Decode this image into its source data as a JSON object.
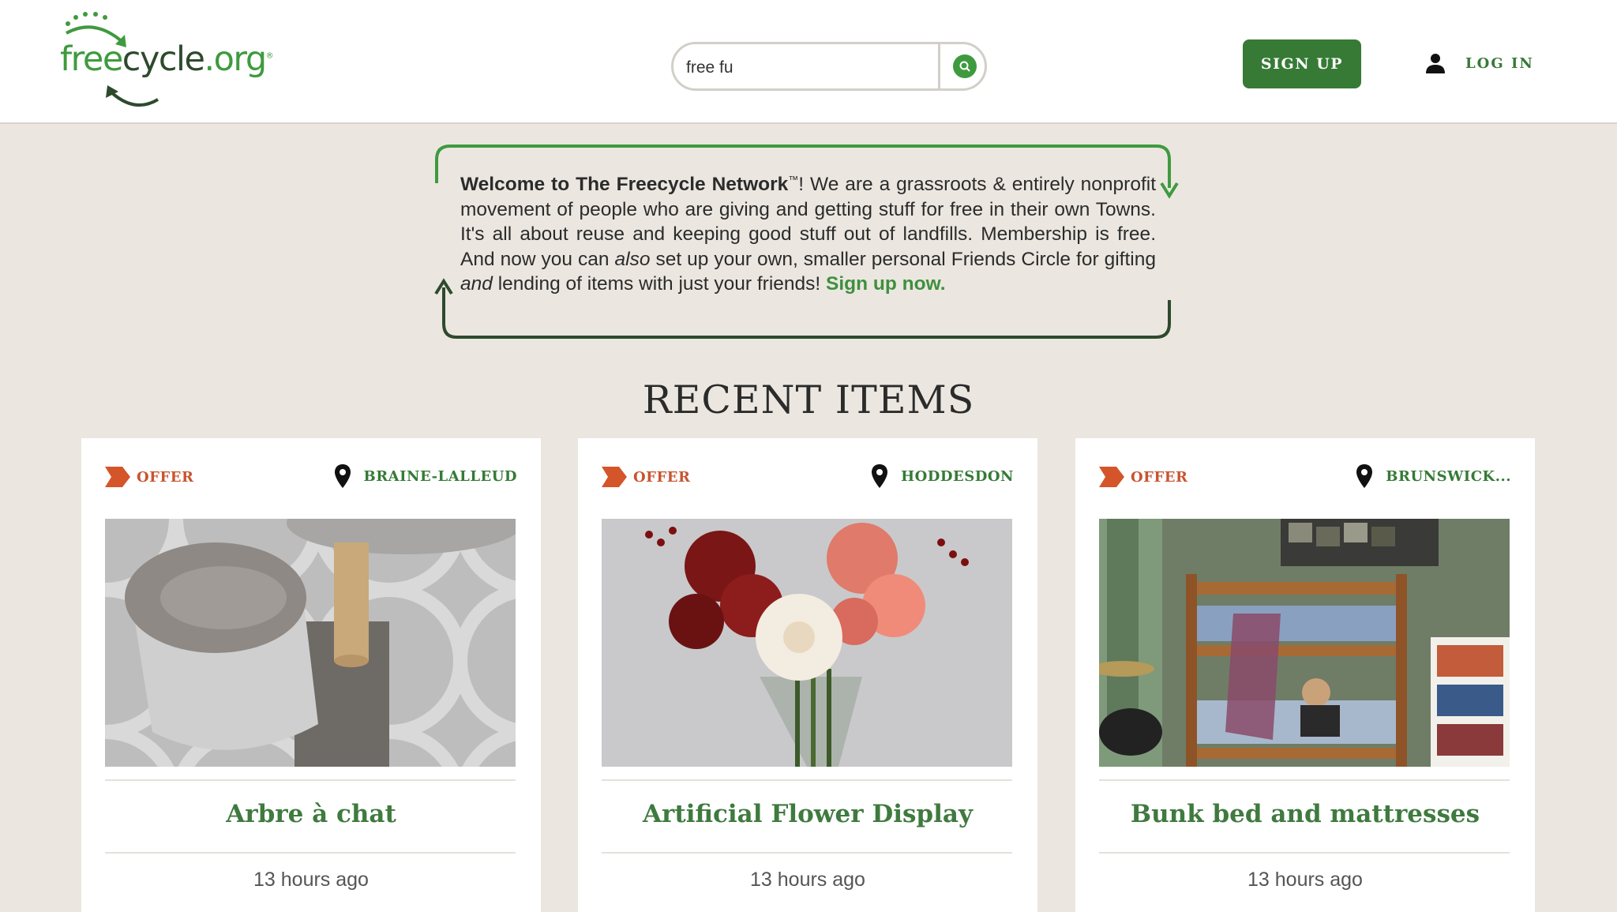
{
  "header": {
    "logo": {
      "free": "free",
      "cycle": "cycle",
      "org": ".org",
      "registered": "®"
    },
    "search": {
      "value": "free fu"
    },
    "signup_label": "SIGN UP",
    "login_label": "LOG IN"
  },
  "welcome": {
    "bold": "Welcome to The Freecycle Network",
    "tm": "™",
    "text1": "! We are a grassroots & entirely nonprofit movement of people who are giving and getting stuff for free in their own Towns. It's all about reuse and keeping good stuff out of landfills. Membership is free. And now you can ",
    "also": "also",
    "text2": " set up your own, smaller personal Friends Circle for gifting ",
    "and": "and",
    "text3": " lending of items with just your friends! ",
    "link": "Sign up now."
  },
  "section_title": "RECENT ITEMS",
  "items": [
    {
      "type": "OFFER",
      "location": "BRAINE-LALLEUD",
      "title": "Arbre à chat",
      "time": "13 hours ago"
    },
    {
      "type": "OFFER",
      "location": "HODDESDON",
      "title": "Artificial Flower Display",
      "time": "13 hours ago"
    },
    {
      "type": "OFFER",
      "location": "BRUNSWICK...",
      "title": "Bunk bed and mattresses",
      "time": "13 hours ago"
    }
  ],
  "colors": {
    "brand_green": "#367a36",
    "light_green": "#3f9a3f",
    "offer_orange": "#c8552f",
    "background": "#ebe7e0"
  }
}
